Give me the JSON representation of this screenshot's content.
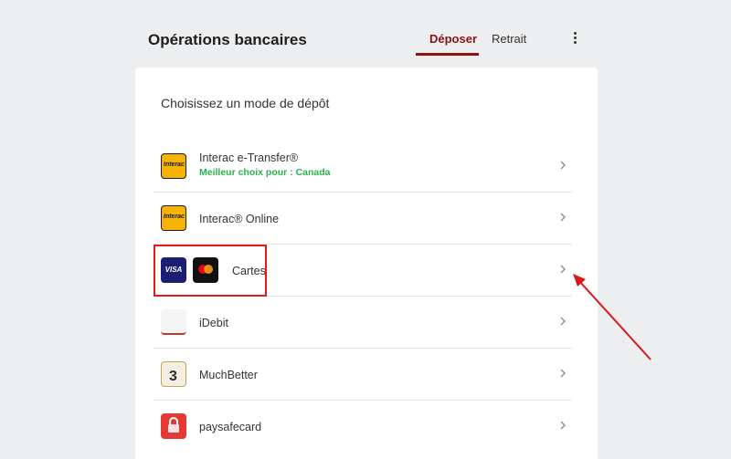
{
  "header": {
    "title": "Opérations bancaires",
    "tab_deposit": "Déposer",
    "tab_withdraw": "Retrait"
  },
  "subtitle": "Choisissez un mode de dépôt",
  "methods": [
    {
      "name": "Interac e-Transfer®",
      "note": "Meilleur choix pour : Canada",
      "logo": "Interac"
    },
    {
      "name": "Interac® Online",
      "logo": "Interac"
    },
    {
      "name": "Cartes",
      "visa": "VISA"
    },
    {
      "name": "iDebit"
    },
    {
      "name": "MuchBetter"
    },
    {
      "name": "paysafecard"
    }
  ],
  "colors": {
    "accent": "#8a1212",
    "highlight": "#e01b1b",
    "note_green": "#2bb24c"
  }
}
